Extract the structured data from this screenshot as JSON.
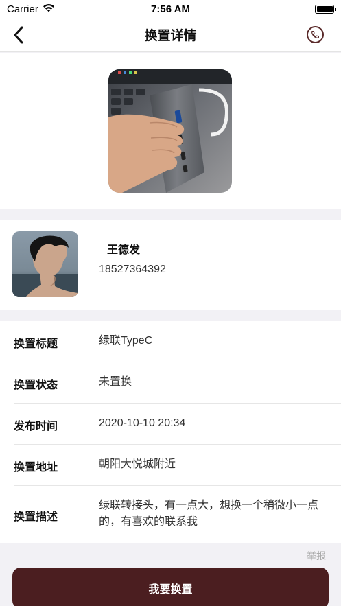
{
  "status_bar": {
    "carrier": "Carrier",
    "time": "7:56 AM"
  },
  "nav": {
    "title": "换置详情",
    "back_icon": "chevron-left-icon",
    "phone_icon": "phone-icon"
  },
  "product": {
    "image_alt": "USB-C hub held in hand"
  },
  "user": {
    "name": "王德发",
    "phone": "18527364392"
  },
  "details": {
    "rows": [
      {
        "label": "换置标题",
        "value": "绿联TypeC"
      },
      {
        "label": "换置状态",
        "value": "未置换"
      },
      {
        "label": "发布时间",
        "value": "2020-10-10 20:34"
      },
      {
        "label": "换置地址",
        "value": "朝阳大悦城附近"
      },
      {
        "label": "换置描述",
        "value": "绿联转接头，有一点大，想换一个稍微小一点的，有喜欢的联系我"
      }
    ]
  },
  "actions": {
    "report_label": "举报",
    "swap_button_label": "我要换置"
  },
  "colors": {
    "accent": "#4b1e20",
    "background": "#f2f1f5"
  }
}
